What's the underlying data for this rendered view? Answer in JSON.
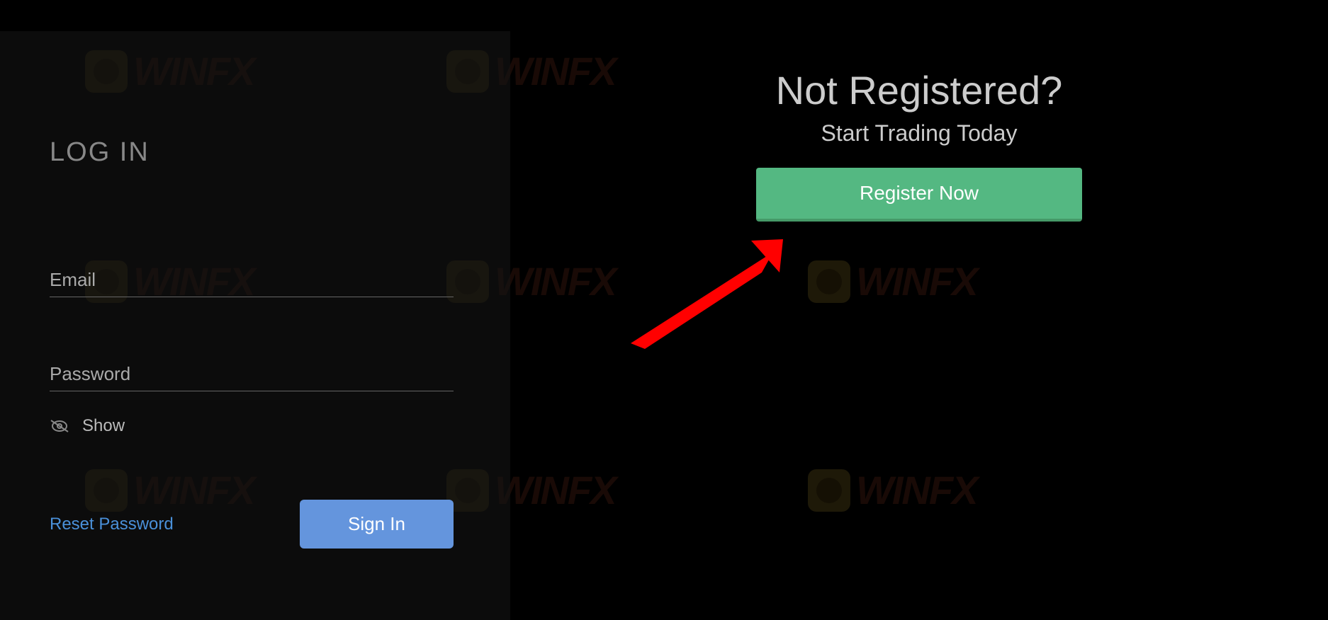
{
  "login": {
    "title": "LOG IN",
    "email_placeholder": "Email",
    "password_placeholder": "Password",
    "show_label": "Show",
    "reset_link": "Reset Password",
    "signin_button": "Sign In"
  },
  "register": {
    "title": "Not Registered?",
    "subtitle": "Start Trading Today",
    "button": "Register Now"
  },
  "watermark": {
    "brand": "WINFX"
  }
}
